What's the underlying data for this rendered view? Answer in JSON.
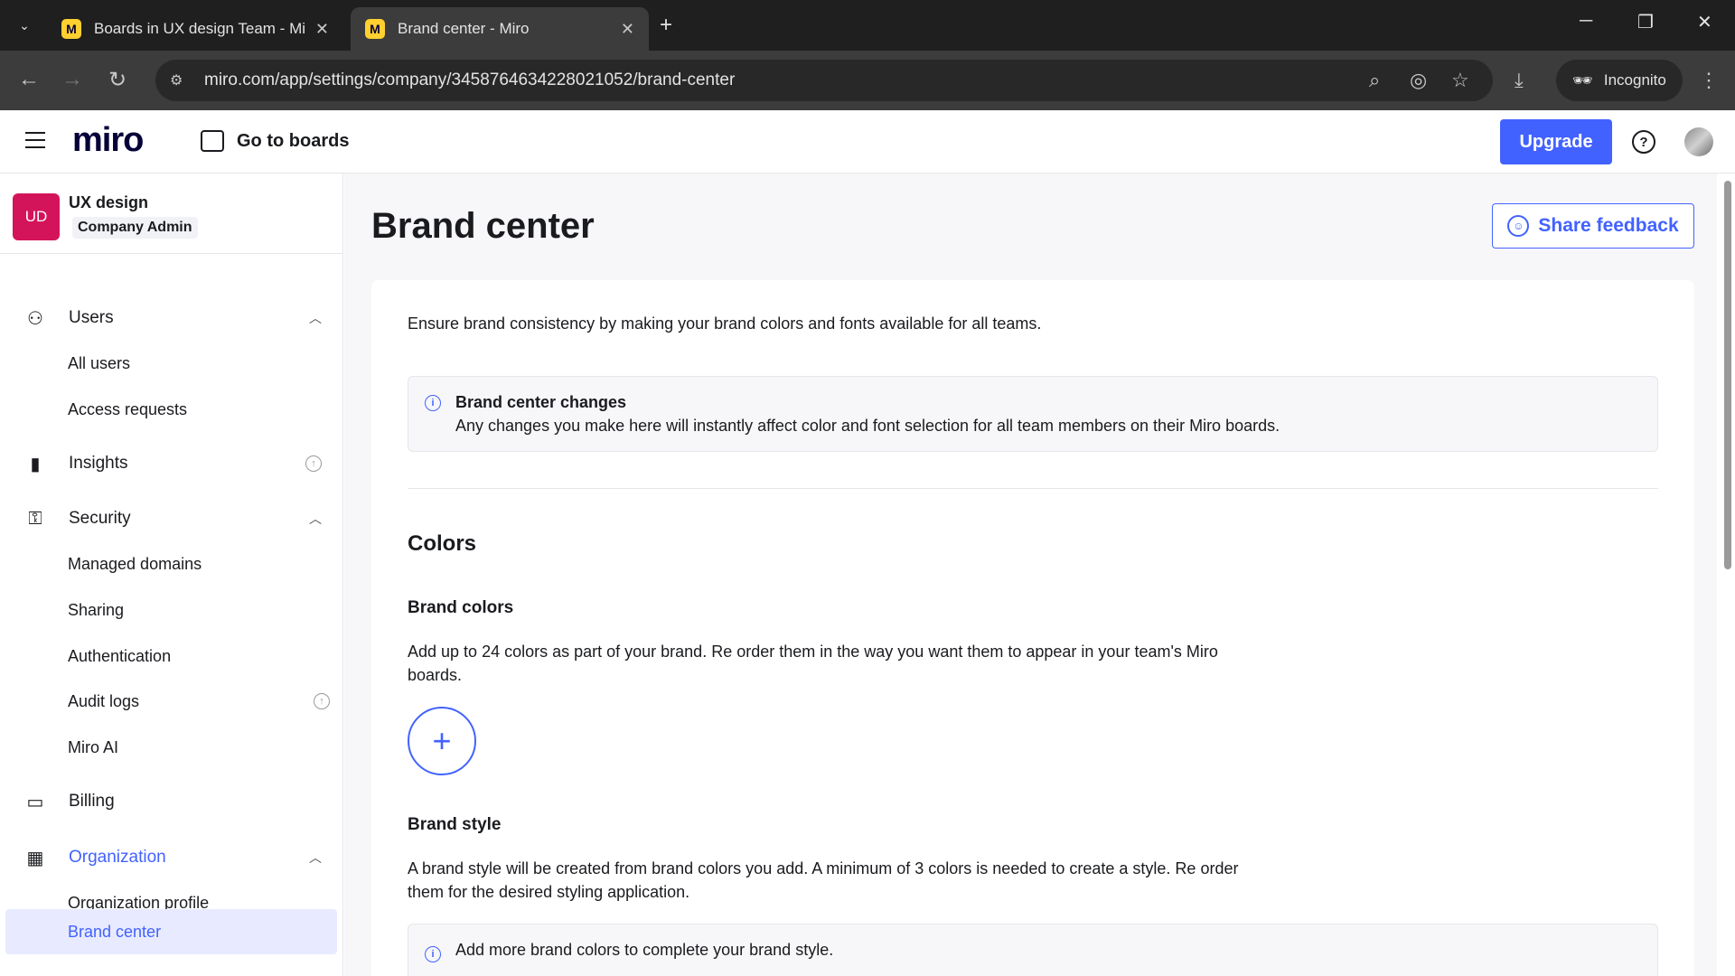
{
  "browser": {
    "tabs": [
      {
        "title": "Boards in UX design Team - Mi",
        "favicon": "miro-favicon"
      },
      {
        "title": "Brand center - Miro",
        "favicon": "miro-favicon"
      }
    ],
    "url": "miro.com/app/settings/company/3458764634228021052/brand-center",
    "incognito_label": "Incognito"
  },
  "header": {
    "logo": "miro",
    "go_to_boards": "Go to boards",
    "upgrade": "Upgrade"
  },
  "sidebar": {
    "org_badge": "UD",
    "org_name": "UX design",
    "org_role": "Company Admin",
    "sections": {
      "users": {
        "label": "Users",
        "items": [
          "All users",
          "Access requests"
        ]
      },
      "insights": {
        "label": "Insights"
      },
      "security": {
        "label": "Security",
        "items": [
          "Managed domains",
          "Sharing",
          "Authentication",
          "Audit logs",
          "Miro AI"
        ]
      },
      "billing": {
        "label": "Billing"
      },
      "organization": {
        "label": "Organization",
        "items": [
          "Organization profile",
          "Brand center"
        ]
      }
    },
    "active_item": "Brand center"
  },
  "main": {
    "title": "Brand center",
    "share_feedback": "Share feedback",
    "intro": "Ensure brand consistency by making your brand colors and fonts available for all teams.",
    "info_title": "Brand center changes",
    "info_body": "Any changes you make here will instantly affect color and font selection for all team members on their Miro boards.",
    "colors_heading": "Colors",
    "brand_colors_heading": "Brand colors",
    "brand_colors_text": "Add up to 24 colors as part of your brand. Re order them in the way you want them to appear in your team's Miro boards.",
    "add_color_symbol": "+",
    "brand_style_heading": "Brand style",
    "brand_style_text": "A brand style will be created from brand colors you add. A minimum of 3 colors is needed to create a style. Re order them for the desired styling application.",
    "brand_style_info": "Add more brand colors to complete your brand style."
  },
  "colors": {
    "accent": "#4262ff",
    "org_badge": "#d4145a",
    "active_bg": "#e8ebff"
  }
}
